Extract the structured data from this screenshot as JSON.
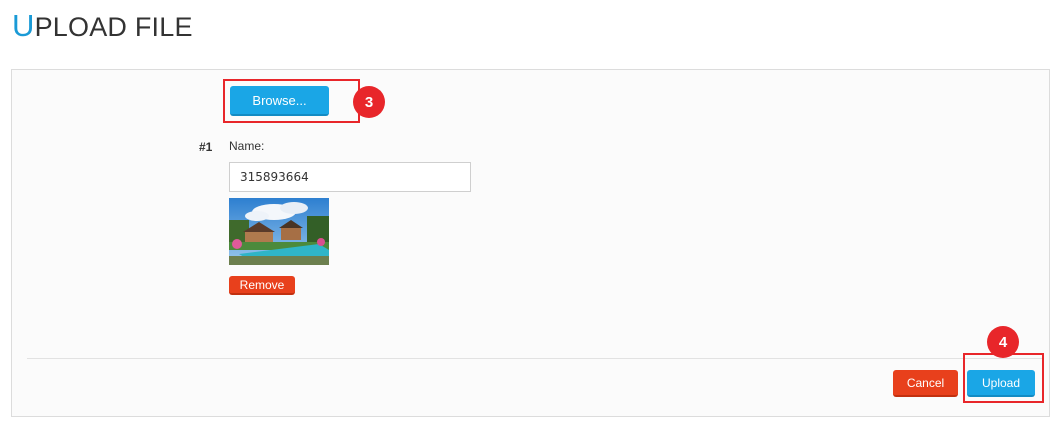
{
  "header": {
    "title_first": "U",
    "title_rest": "PLOAD FILE"
  },
  "upload": {
    "browse_label": "Browse...",
    "item_number": "#1",
    "name_label": "Name:",
    "name_value": "315893664",
    "remove_label": "Remove"
  },
  "annotations": {
    "step_browse": "3",
    "step_upload": "4"
  },
  "footer": {
    "cancel_label": "Cancel",
    "upload_label": "Upload"
  },
  "colors": {
    "accent": "#1aa6e6",
    "danger": "#e8401c",
    "callout": "#e8262a"
  }
}
